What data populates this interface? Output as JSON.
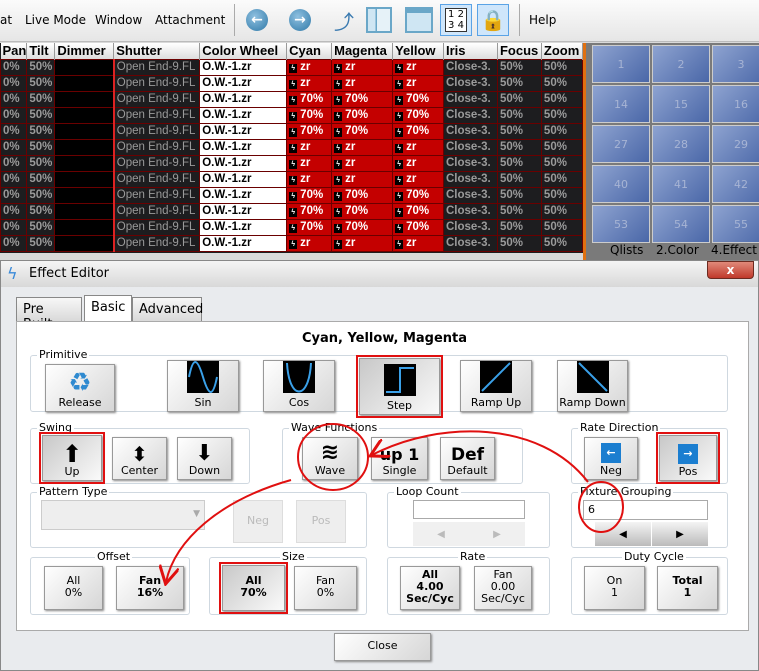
{
  "menu": {
    "items": [
      "at",
      "Live Mode",
      "Window",
      "Attachment",
      "Help"
    ]
  },
  "toolbar": {
    "icons": [
      "back-arrow-icon",
      "forward-arrow-icon",
      "open-folder-icon",
      "sidebar-layout-icon",
      "window-layout-icon",
      "numbered-grid-icon",
      "lock-icon"
    ],
    "grid_label": "1 2 3 4"
  },
  "grid": {
    "columns": [
      "Pan",
      "Tilt",
      "Dimmer",
      "Shutter",
      "Color Wheel",
      "Cyan",
      "Magenta",
      "Yellow",
      "Iris",
      "Focus",
      "Zoom"
    ],
    "rows": [
      [
        "0%",
        "50%",
        "",
        "Open End-9.FL",
        "O.W.-1.zr",
        "zr",
        "zr",
        "zr",
        "Close-3.",
        "50%",
        "50%"
      ],
      [
        "0%",
        "50%",
        "",
        "Open End-9.FL",
        "O.W.-1.zr",
        "zr",
        "zr",
        "zr",
        "Close-3.",
        "50%",
        "50%"
      ],
      [
        "0%",
        "50%",
        "",
        "Open End-9.FL",
        "O.W.-1.zr",
        "70%",
        "70%",
        "70%",
        "Close-3.",
        "50%",
        "50%"
      ],
      [
        "0%",
        "50%",
        "",
        "Open End-9.FL",
        "O.W.-1.zr",
        "70%",
        "70%",
        "70%",
        "Close-3.",
        "50%",
        "50%"
      ],
      [
        "0%",
        "50%",
        "",
        "Open End-9.FL",
        "O.W.-1.zr",
        "70%",
        "70%",
        "70%",
        "Close-3.",
        "50%",
        "50%"
      ],
      [
        "0%",
        "50%",
        "",
        "Open End-9.FL",
        "O.W.-1.zr",
        "zr",
        "zr",
        "zr",
        "Close-3.",
        "50%",
        "50%"
      ],
      [
        "0%",
        "50%",
        "",
        "Open End-9.FL",
        "O.W.-1.zr",
        "zr",
        "zr",
        "zr",
        "Close-3.",
        "50%",
        "50%"
      ],
      [
        "0%",
        "50%",
        "",
        "Open End-9.FL",
        "O.W.-1.zr",
        "zr",
        "zr",
        "zr",
        "Close-3.",
        "50%",
        "50%"
      ],
      [
        "0%",
        "50%",
        "",
        "Open End-9.FL",
        "O.W.-1.zr",
        "70%",
        "70%",
        "70%",
        "Close-3.",
        "50%",
        "50%"
      ],
      [
        "0%",
        "50%",
        "",
        "Open End-9.FL",
        "O.W.-1.zr",
        "70%",
        "70%",
        "70%",
        "Close-3.",
        "50%",
        "50%"
      ],
      [
        "0%",
        "50%",
        "",
        "Open End-9.FL",
        "O.W.-1.zr",
        "70%",
        "70%",
        "70%",
        "Close-3.",
        "50%",
        "50%"
      ],
      [
        "0%",
        "50%",
        "",
        "Open End-9.FL",
        "O.W.-1.zr",
        "zr",
        "zr",
        "zr",
        "Close-3.",
        "50%",
        "50%"
      ]
    ],
    "highlight_color": "#c40000"
  },
  "palette": {
    "cells": [
      "1",
      "2",
      "3",
      "14",
      "15",
      "16",
      "27",
      "28",
      "29",
      "40",
      "41",
      "42",
      "53",
      "54",
      "55"
    ],
    "tabs": [
      "Qlists",
      "2.Color",
      "4.Effect"
    ]
  },
  "dialog": {
    "title": "Effect Editor",
    "close_x": "x",
    "tabs": [
      "Pre Built",
      "Basic",
      "Advanced"
    ],
    "active_tab": "Basic",
    "heading": "Cyan, Yellow, Magenta",
    "primitive": {
      "label": "Primitive",
      "buttons": [
        "Release",
        "Sin",
        "Cos",
        "Step",
        "Ramp Up",
        "Ramp Down"
      ],
      "selected": "Step"
    },
    "swing": {
      "label": "Swing",
      "buttons": [
        "Up",
        "Center",
        "Down"
      ],
      "selected": "Up"
    },
    "wave_functions": {
      "label": "Wave Functions",
      "buttons": [
        "Wave",
        "Single",
        "Default"
      ],
      "single_glyph": "up 1",
      "default_glyph": "Def"
    },
    "rate_direction": {
      "label": "Rate Direction",
      "buttons": [
        "Neg",
        "Pos"
      ],
      "selected": "Pos"
    },
    "pattern_type": {
      "label": "Pattern Type",
      "value": "",
      "buttons": [
        "Neg",
        "Pos"
      ]
    },
    "loop_count": {
      "label": "Loop Count",
      "value": ""
    },
    "fixture_grouping": {
      "label": "Fixture Grouping",
      "value": "6"
    },
    "offset": {
      "label": "Offset",
      "all": [
        "All",
        "0%"
      ],
      "fan": [
        "Fan",
        "16%"
      ]
    },
    "size": {
      "label": "Size",
      "all": [
        "All",
        "70%"
      ],
      "fan": [
        "Fan",
        "0%"
      ]
    },
    "rate": {
      "label": "Rate",
      "all": [
        "All",
        "4.00",
        "Sec/Cyc"
      ],
      "fan": [
        "Fan",
        "0.00",
        "Sec/Cyc"
      ]
    },
    "duty_cycle": {
      "label": "Duty Cycle",
      "on": [
        "On",
        "1"
      ],
      "total": [
        "Total",
        "1"
      ]
    },
    "close_label": "Close",
    "annotation_color": "#e01010"
  }
}
